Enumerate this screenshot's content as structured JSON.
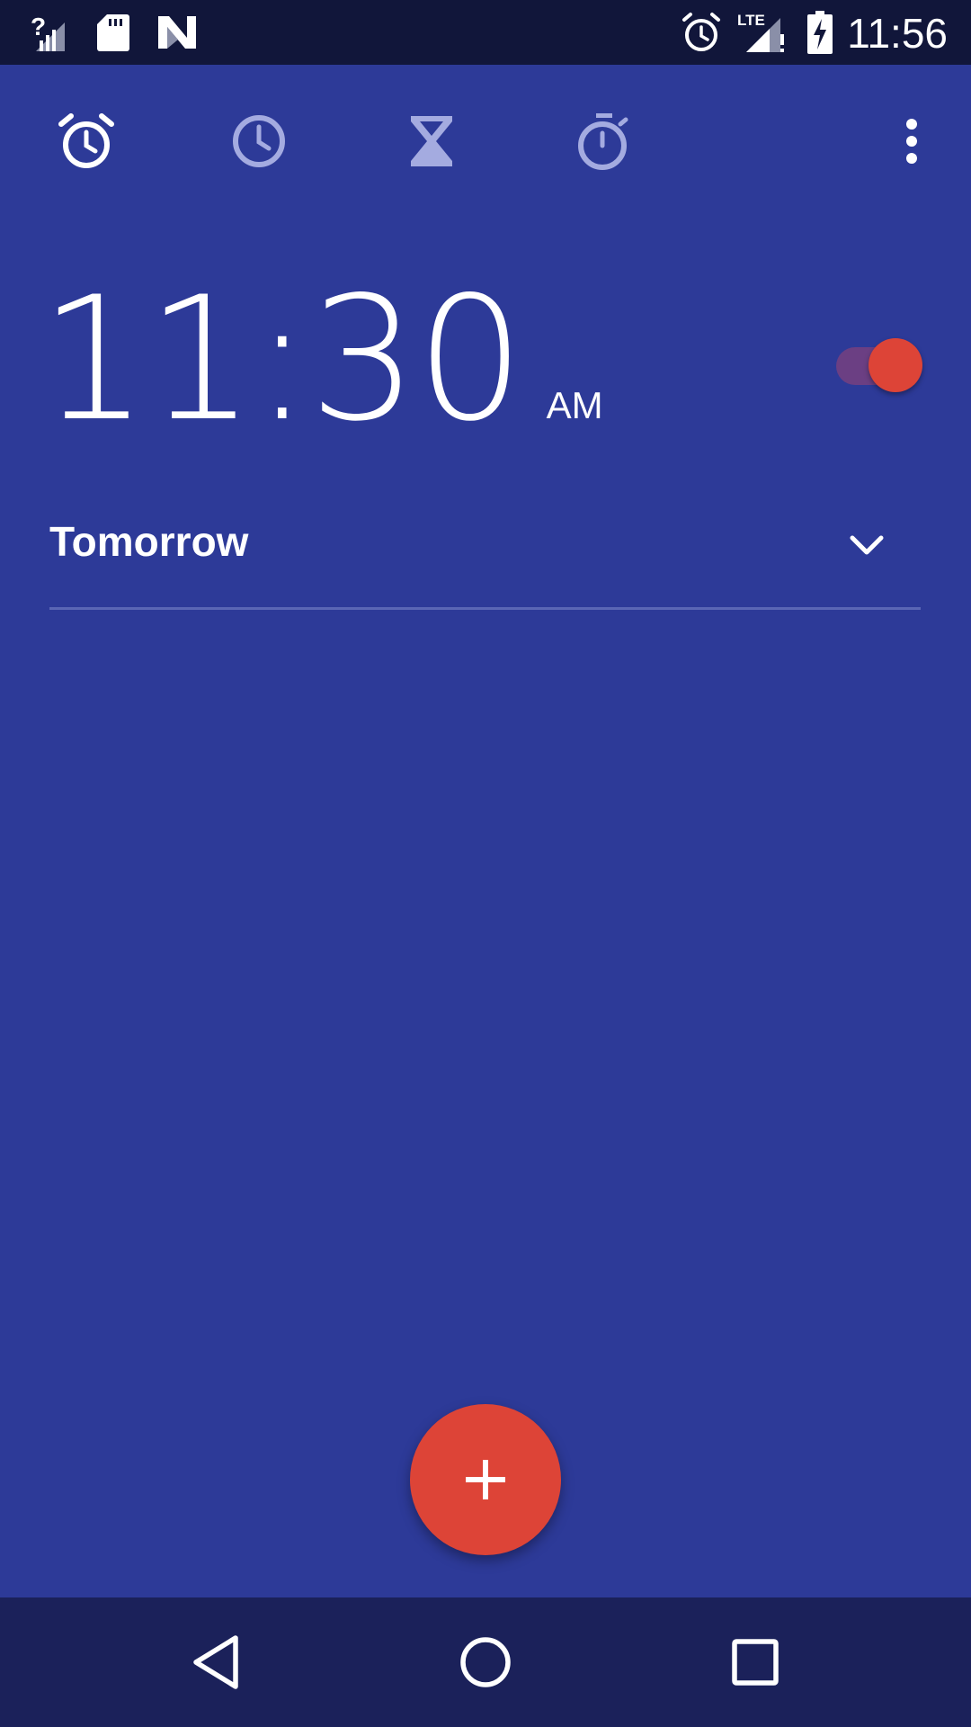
{
  "status_bar": {
    "time": "11:56",
    "network_type": "LTE",
    "icons": [
      "signal-unknown-icon",
      "sd-card-icon",
      "android-n-icon",
      "alarm-icon",
      "lte-signal-icon",
      "battery-charging-icon"
    ]
  },
  "tabs": [
    {
      "name": "alarm",
      "icon": "alarm-icon",
      "selected": true
    },
    {
      "name": "clock",
      "icon": "clock-icon",
      "selected": false
    },
    {
      "name": "timer",
      "icon": "hourglass-icon",
      "selected": false
    },
    {
      "name": "stopwatch",
      "icon": "stopwatch-icon",
      "selected": false
    }
  ],
  "overflow_menu": {
    "icon": "more-vert-icon"
  },
  "alarm": {
    "time": "11:30",
    "ampm": "AM",
    "enabled": true,
    "day_label": "Tomorrow"
  },
  "fab": {
    "label": "+",
    "icon": "add-icon"
  },
  "nav_bar": {
    "buttons": [
      "back-icon",
      "home-icon",
      "recents-icon"
    ]
  },
  "colors": {
    "background": "#2d3a98",
    "status_bar": "#11163a",
    "nav_bar": "#1b215a",
    "accent": "#dd4437",
    "toggle_track": "#6b3f83",
    "inactive_icon": "#a4abe0",
    "divider": "#5a66b4"
  }
}
